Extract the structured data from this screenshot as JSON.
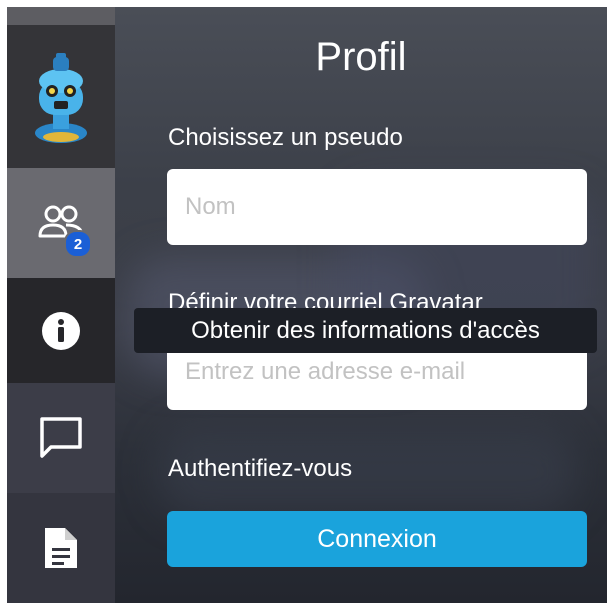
{
  "profile": {
    "title": "Profil",
    "nickname_label": "Choisissez un pseudo",
    "nickname_placeholder": "Nom",
    "gravatar_label": "Définir votre courriel Gravatar",
    "email_placeholder": "Entrez une adresse e-mail",
    "auth_label": "Authentifiez-vous",
    "login_button": "Connexion"
  },
  "sidebar": {
    "users_badge": "2",
    "icons": [
      "avatar-robot",
      "users-icon",
      "info-icon",
      "chat-icon",
      "document-icon"
    ]
  },
  "tooltip": {
    "text": "Obtenir des informations d'accès"
  },
  "colors": {
    "accent": "#1aa3dc",
    "badge": "#1b5fd6"
  }
}
